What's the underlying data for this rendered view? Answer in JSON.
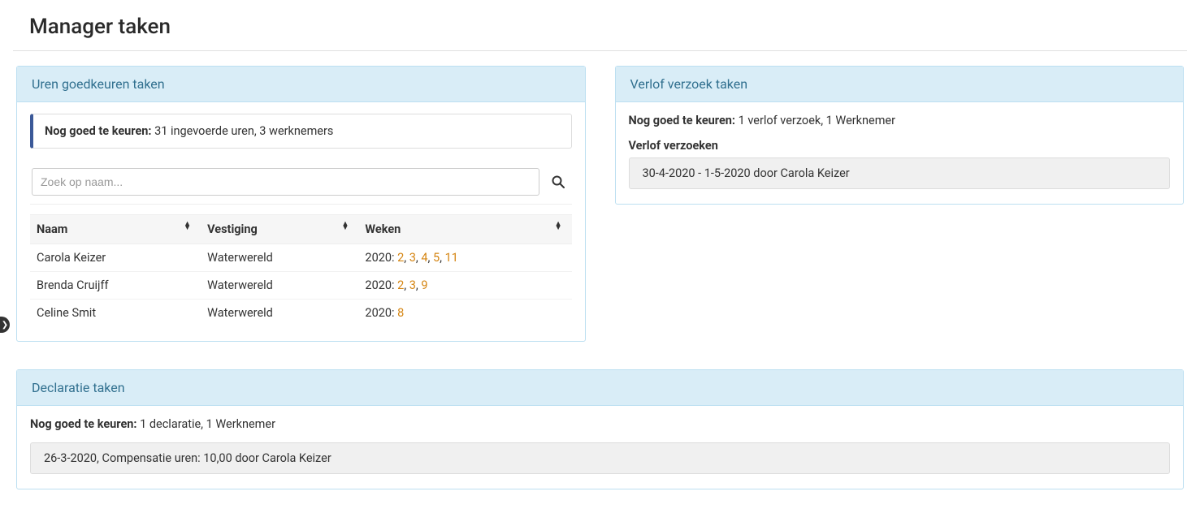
{
  "pageTitle": "Manager taken",
  "panels": {
    "hours": {
      "title": "Uren goedkeuren taken",
      "pendingLabel": "Nog goed te keuren:",
      "pendingText": "31 ingevoerde uren, 3 werknemers",
      "searchPlaceholder": "Zoek op naam...",
      "columns": {
        "name": "Naam",
        "location": "Vestiging",
        "weeks": "Weken"
      },
      "rows": [
        {
          "name": "Carola Keizer",
          "location": "Waterwereld",
          "year": "2020:",
          "weeks": [
            "2",
            "3",
            "4",
            "5",
            "11"
          ]
        },
        {
          "name": "Brenda Cruijff",
          "location": "Waterwereld",
          "year": "2020:",
          "weeks": [
            "2",
            "3",
            "9"
          ]
        },
        {
          "name": "Celine Smit",
          "location": "Waterwereld",
          "year": "2020:",
          "weeks": [
            "8"
          ]
        }
      ]
    },
    "leave": {
      "title": "Verlof verzoek taken",
      "pendingLabel": "Nog goed te keuren:",
      "pendingText": "1 verlof verzoek, 1 Werknemer",
      "subheading": "Verlof verzoeken",
      "items": [
        {
          "text": "30-4-2020 - 1-5-2020 door Carola Keizer"
        }
      ]
    },
    "expenses": {
      "title": "Declaratie taken",
      "pendingLabel": "Nog goed te keuren:",
      "pendingText": "1 declaratie, 1 Werknemer",
      "items": [
        {
          "text": "26-3-2020, Compensatie uren: 10,00 door Carola Keizer"
        }
      ]
    }
  }
}
